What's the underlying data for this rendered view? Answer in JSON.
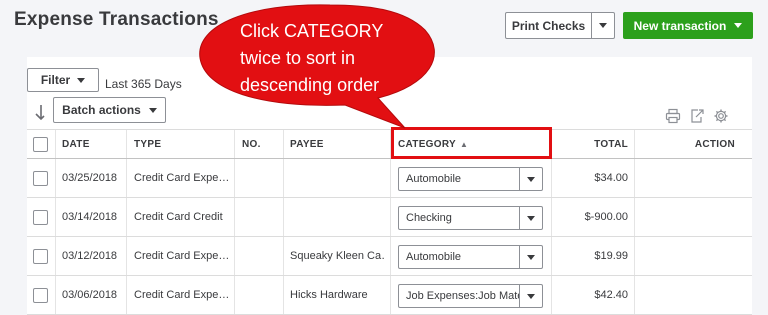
{
  "page": {
    "title": "Expense Transactions"
  },
  "header": {
    "print_checks_label": "Print Checks",
    "new_transaction_label": "New transaction"
  },
  "filter": {
    "label": "Filter",
    "range_text": "Last 365 Days"
  },
  "batch_actions_label": "Batch actions",
  "table": {
    "columns": [
      "DATE",
      "TYPE",
      "NO.",
      "PAYEE",
      "CATEGORY",
      "TOTAL",
      "ACTION"
    ],
    "sort_indicator": "▲",
    "rows": [
      {
        "date": "03/25/2018",
        "type": "Credit Card Expe…",
        "no": "",
        "payee": "",
        "category": "Automobile",
        "total": "$34.00"
      },
      {
        "date": "03/14/2018",
        "type": "Credit Card Credit",
        "no": "",
        "payee": "",
        "category": "Checking",
        "total": "$-900.00"
      },
      {
        "date": "03/12/2018",
        "type": "Credit Card Expe…",
        "no": "",
        "payee": "Squeaky Kleen Ca…",
        "category": "Automobile",
        "total": "$19.99"
      },
      {
        "date": "03/06/2018",
        "type": "Credit Card Expe…",
        "no": "",
        "payee": "Hicks Hardware",
        "category": "Job Expenses:Job Mate",
        "total": "$42.40"
      }
    ]
  },
  "callout": {
    "line1": "Click CATEGORY",
    "line2": "twice to sort in",
    "line3": "descending order",
    "color": "#e20f12"
  },
  "colors": {
    "accent_green": "#2ca01c",
    "highlight_red": "#e20f12"
  },
  "icons": [
    "caret-down-icon",
    "sort-arrow-icon",
    "printer-icon",
    "export-icon",
    "gear-icon"
  ]
}
